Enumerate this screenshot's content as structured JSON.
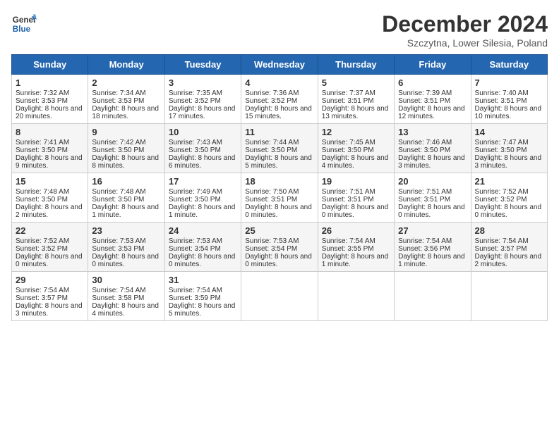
{
  "header": {
    "logo_line1": "General",
    "logo_line2": "Blue",
    "month": "December 2024",
    "location": "Szczytna, Lower Silesia, Poland"
  },
  "weekdays": [
    "Sunday",
    "Monday",
    "Tuesday",
    "Wednesday",
    "Thursday",
    "Friday",
    "Saturday"
  ],
  "weeks": [
    [
      {
        "day": "1",
        "sunrise": "7:32 AM",
        "sunset": "3:53 PM",
        "daylight": "8 hours and 20 minutes."
      },
      {
        "day": "2",
        "sunrise": "7:34 AM",
        "sunset": "3:53 PM",
        "daylight": "8 hours and 18 minutes."
      },
      {
        "day": "3",
        "sunrise": "7:35 AM",
        "sunset": "3:52 PM",
        "daylight": "8 hours and 17 minutes."
      },
      {
        "day": "4",
        "sunrise": "7:36 AM",
        "sunset": "3:52 PM",
        "daylight": "8 hours and 15 minutes."
      },
      {
        "day": "5",
        "sunrise": "7:37 AM",
        "sunset": "3:51 PM",
        "daylight": "8 hours and 13 minutes."
      },
      {
        "day": "6",
        "sunrise": "7:39 AM",
        "sunset": "3:51 PM",
        "daylight": "8 hours and 12 minutes."
      },
      {
        "day": "7",
        "sunrise": "7:40 AM",
        "sunset": "3:51 PM",
        "daylight": "8 hours and 10 minutes."
      }
    ],
    [
      {
        "day": "8",
        "sunrise": "7:41 AM",
        "sunset": "3:50 PM",
        "daylight": "8 hours and 9 minutes."
      },
      {
        "day": "9",
        "sunrise": "7:42 AM",
        "sunset": "3:50 PM",
        "daylight": "8 hours and 8 minutes."
      },
      {
        "day": "10",
        "sunrise": "7:43 AM",
        "sunset": "3:50 PM",
        "daylight": "8 hours and 6 minutes."
      },
      {
        "day": "11",
        "sunrise": "7:44 AM",
        "sunset": "3:50 PM",
        "daylight": "8 hours and 5 minutes."
      },
      {
        "day": "12",
        "sunrise": "7:45 AM",
        "sunset": "3:50 PM",
        "daylight": "8 hours and 4 minutes."
      },
      {
        "day": "13",
        "sunrise": "7:46 AM",
        "sunset": "3:50 PM",
        "daylight": "8 hours and 3 minutes."
      },
      {
        "day": "14",
        "sunrise": "7:47 AM",
        "sunset": "3:50 PM",
        "daylight": "8 hours and 3 minutes."
      }
    ],
    [
      {
        "day": "15",
        "sunrise": "7:48 AM",
        "sunset": "3:50 PM",
        "daylight": "8 hours and 2 minutes."
      },
      {
        "day": "16",
        "sunrise": "7:48 AM",
        "sunset": "3:50 PM",
        "daylight": "8 hours and 1 minute."
      },
      {
        "day": "17",
        "sunrise": "7:49 AM",
        "sunset": "3:50 PM",
        "daylight": "8 hours and 1 minute."
      },
      {
        "day": "18",
        "sunrise": "7:50 AM",
        "sunset": "3:51 PM",
        "daylight": "8 hours and 0 minutes."
      },
      {
        "day": "19",
        "sunrise": "7:51 AM",
        "sunset": "3:51 PM",
        "daylight": "8 hours and 0 minutes."
      },
      {
        "day": "20",
        "sunrise": "7:51 AM",
        "sunset": "3:51 PM",
        "daylight": "8 hours and 0 minutes."
      },
      {
        "day": "21",
        "sunrise": "7:52 AM",
        "sunset": "3:52 PM",
        "daylight": "8 hours and 0 minutes."
      }
    ],
    [
      {
        "day": "22",
        "sunrise": "7:52 AM",
        "sunset": "3:52 PM",
        "daylight": "8 hours and 0 minutes."
      },
      {
        "day": "23",
        "sunrise": "7:53 AM",
        "sunset": "3:53 PM",
        "daylight": "8 hours and 0 minutes."
      },
      {
        "day": "24",
        "sunrise": "7:53 AM",
        "sunset": "3:54 PM",
        "daylight": "8 hours and 0 minutes."
      },
      {
        "day": "25",
        "sunrise": "7:53 AM",
        "sunset": "3:54 PM",
        "daylight": "8 hours and 0 minutes."
      },
      {
        "day": "26",
        "sunrise": "7:54 AM",
        "sunset": "3:55 PM",
        "daylight": "8 hours and 1 minute."
      },
      {
        "day": "27",
        "sunrise": "7:54 AM",
        "sunset": "3:56 PM",
        "daylight": "8 hours and 1 minute."
      },
      {
        "day": "28",
        "sunrise": "7:54 AM",
        "sunset": "3:57 PM",
        "daylight": "8 hours and 2 minutes."
      }
    ],
    [
      {
        "day": "29",
        "sunrise": "7:54 AM",
        "sunset": "3:57 PM",
        "daylight": "8 hours and 3 minutes."
      },
      {
        "day": "30",
        "sunrise": "7:54 AM",
        "sunset": "3:58 PM",
        "daylight": "8 hours and 4 minutes."
      },
      {
        "day": "31",
        "sunrise": "7:54 AM",
        "sunset": "3:59 PM",
        "daylight": "8 hours and 5 minutes."
      },
      null,
      null,
      null,
      null
    ]
  ]
}
